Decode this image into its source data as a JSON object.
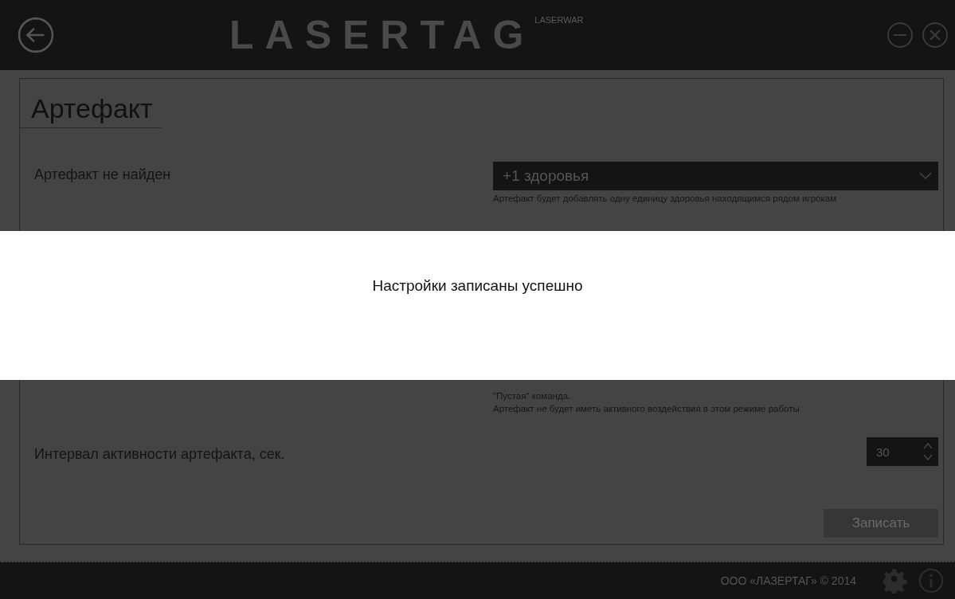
{
  "header": {
    "logo": "LASERTAG",
    "brand": "LASERWAR"
  },
  "panel": {
    "title": "Артефакт",
    "artifact_row": {
      "label": "Артефакт не найден",
      "value": "+1  здоровья",
      "hint": "Артефакт будет добавлять одну единицу здоровья находящимся рядом игрокам"
    },
    "team_hint": [
      "\"Пустая\" команда.",
      "Артефакт не будет иметь активного воздействия в этом режиме работы"
    ],
    "interval_row": {
      "label": "Интервал активности артефакта, сек.",
      "value": "30"
    },
    "save_button": "Записать"
  },
  "footer": {
    "copyright": "ООО «ЛАЗЕРТАГ» © 2014"
  },
  "notification": {
    "message": "Настройки записаны успешно"
  }
}
